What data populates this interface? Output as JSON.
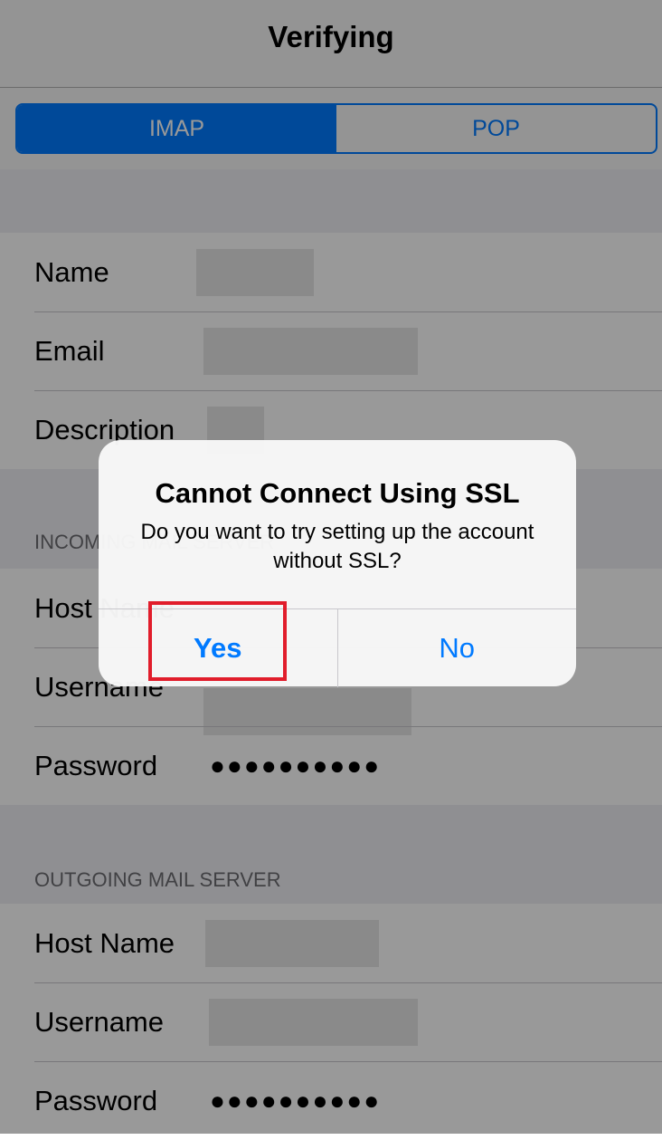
{
  "nav": {
    "title": "Verifying"
  },
  "segments": [
    {
      "label": "IMAP",
      "active": true
    },
    {
      "label": "POP",
      "active": false
    }
  ],
  "account": {
    "rows": [
      {
        "label": "Name"
      },
      {
        "label": "Email"
      },
      {
        "label": "Description"
      }
    ]
  },
  "incoming": {
    "header": "INCOMING MAIL SERVER",
    "rows": [
      {
        "label": "Host Name"
      },
      {
        "label": "Username"
      },
      {
        "label": "Password",
        "value": "●●●●●●●●●●"
      }
    ]
  },
  "outgoing": {
    "header": "OUTGOING MAIL SERVER",
    "rows": [
      {
        "label": "Host Name"
      },
      {
        "label": "Username"
      },
      {
        "label": "Password",
        "value": "●●●●●●●●●●"
      }
    ]
  },
  "alert": {
    "title": "Cannot Connect Using SSL",
    "message": "Do you want to try setting up the account without SSL?",
    "yes_label": "Yes",
    "no_label": "No"
  },
  "colors": {
    "accent": "#007aff",
    "highlight": "#e11d2b"
  }
}
